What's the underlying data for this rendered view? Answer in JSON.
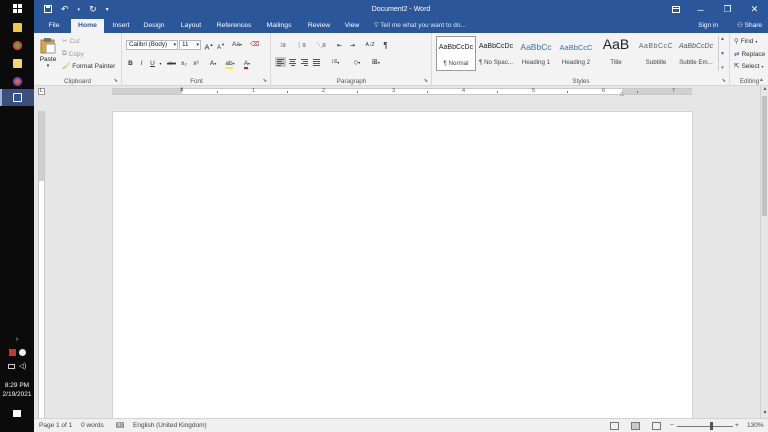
{
  "window": {
    "title": "Document2 - Word"
  },
  "quick_access": {
    "save_icon": "save-icon",
    "undo_icon": "undo-icon",
    "redo_icon": "redo-icon",
    "customize_icon": "customize-qat-icon"
  },
  "title_controls": {
    "ribbon_display_icon": "ribbon-display-options-icon",
    "minimize": "─",
    "restore": "❐",
    "close": "✕"
  },
  "tabs": [
    {
      "label": "File"
    },
    {
      "label": "Home"
    },
    {
      "label": "Insert"
    },
    {
      "label": "Design"
    },
    {
      "label": "Layout"
    },
    {
      "label": "References"
    },
    {
      "label": "Mailings"
    },
    {
      "label": "Review"
    },
    {
      "label": "View"
    }
  ],
  "tell_me": {
    "placeholder": "Tell me what you want to do..."
  },
  "account": {
    "sign_in": "Sign in",
    "share": "Share"
  },
  "clipboard": {
    "paste": "Paste",
    "cut": "Cut",
    "copy": "Copy",
    "format_painter": "Format Painter",
    "label": "Clipboard"
  },
  "font": {
    "name": "Calibri (Body)",
    "size": "11",
    "grow": "A",
    "shrink": "A",
    "change_case": "Aa",
    "bold": "B",
    "italic": "I",
    "underline": "U",
    "strike": "abc",
    "subscript": "x₂",
    "superscript": "x²",
    "effects": "A",
    "highlight": "ab",
    "color": "A",
    "label": "Font"
  },
  "paragraph": {
    "sort": "A↓Z",
    "pilcrow": "¶",
    "label": "Paragraph"
  },
  "styles": {
    "items": [
      {
        "sample": "AaBbCcDc",
        "name": "¶ Normal"
      },
      {
        "sample": "AaBbCcDc",
        "name": "¶ No Spac..."
      },
      {
        "sample": "AaBbCc",
        "name": "Heading 1"
      },
      {
        "sample": "AaBbCcC",
        "name": "Heading 2"
      },
      {
        "sample": "AaB",
        "name": "Title"
      },
      {
        "sample": "AaBbCcC",
        "name": "Subtitle"
      },
      {
        "sample": "AaBbCcDc",
        "name": "Subtle Em..."
      }
    ],
    "label": "Styles"
  },
  "editing": {
    "find": "Find",
    "replace": "Replace",
    "select": "Select",
    "label": "Editing"
  },
  "ruler": {
    "numbers": [
      "1",
      "2",
      "3",
      "4",
      "5",
      "6",
      "7"
    ],
    "tab_selector": "L"
  },
  "status": {
    "page": "Page 1 of 1",
    "words": "0 words",
    "language": "English (United Kingdom)",
    "zoom": "130%",
    "zoom_minus": "−",
    "zoom_plus": "+",
    "zoom_level": 0.6
  },
  "taskbar": {
    "start_icon": "windows-start-icon",
    "apps": [
      {
        "icon": "file-explorer-icon",
        "color": "#f2c84b"
      },
      {
        "icon": "chrome-icon",
        "color": "#4caf50"
      },
      {
        "icon": "sticky-notes-icon",
        "color": "#f5d76e"
      },
      {
        "icon": "firefox-icon",
        "color": "#e66a1f"
      },
      {
        "icon": "word-icon",
        "color": "#2b579a"
      }
    ],
    "tray_expand": "›",
    "time": "8:29 PM",
    "date": "2/19/2021",
    "notifications_icon": "action-center-icon"
  },
  "colors": {
    "word_blue": "#2b579a",
    "ribbon_bg": "#f3f3f3",
    "canvas_bg": "#e6e6e6",
    "heading_blue": "#2e74b5"
  }
}
